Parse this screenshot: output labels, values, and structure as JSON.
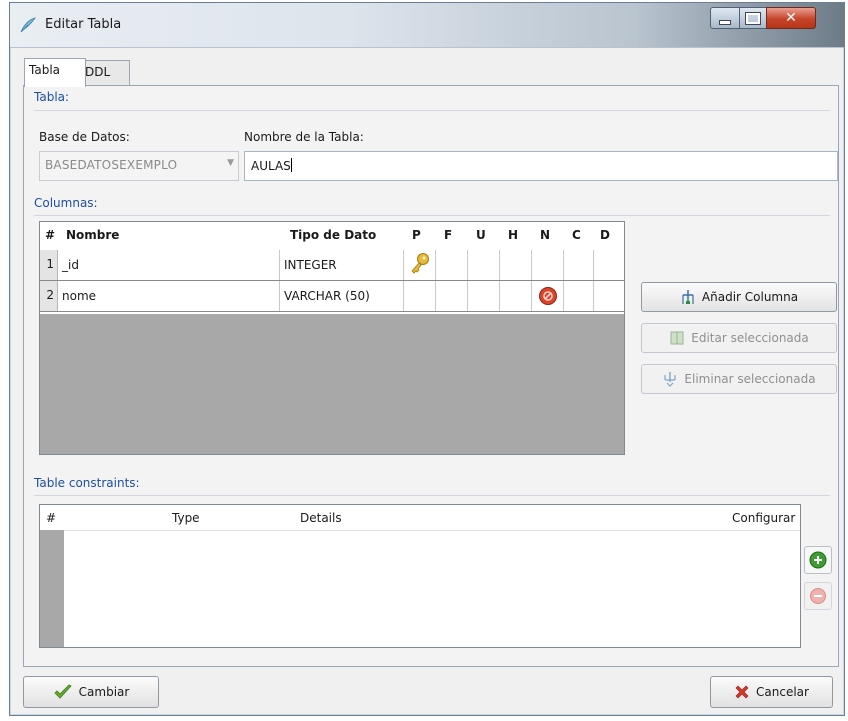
{
  "window": {
    "title": "Editar Tabla"
  },
  "tabs": [
    {
      "label": "Tabla"
    },
    {
      "label": "DDL"
    }
  ],
  "tabla_section": {
    "title": "Tabla:",
    "db_label": "Base de Datos:",
    "db_value": "BASEDATOSEXEMPLO",
    "name_label": "Nombre de la Tabla:",
    "name_value": "AULAS"
  },
  "columns_section": {
    "title": "Columnas:",
    "headers": {
      "num": "#",
      "name": "Nombre",
      "type": "Tipo de Dato",
      "p": "P",
      "f": "F",
      "u": "U",
      "h": "H",
      "n": "N",
      "c": "C",
      "d": "D"
    },
    "rows": [
      {
        "num": "1",
        "name": "_id",
        "type": "INTEGER",
        "flags": {
          "p": true,
          "n": false
        }
      },
      {
        "num": "2",
        "name": "nome",
        "type": "VARCHAR (50)",
        "flags": {
          "p": false,
          "n": true
        }
      }
    ],
    "buttons": {
      "add": "Añadir Columna",
      "edit": "Editar seleccionada",
      "delete": "Eliminar seleccionada"
    }
  },
  "constraints_section": {
    "title": "Table constraints:",
    "headers": {
      "num": "#",
      "type": "Type",
      "details": "Details",
      "config": "Configurar"
    }
  },
  "footer": {
    "apply": "Cambiar",
    "cancel": "Cancelar"
  },
  "colors": {
    "section_title": "#1f4fa0",
    "close_button": "#c6442a",
    "key_icon": "#e2b43a",
    "not_null_icon": "#d9452a",
    "add_icon": "#3f9b35",
    "remove_icon": "#e08a86"
  }
}
